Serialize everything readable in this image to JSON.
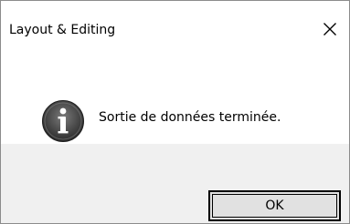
{
  "window": {
    "title": "Layout & Editing",
    "close_icon": "close-icon"
  },
  "message": {
    "icon": "info-icon",
    "text": "Sortie de données terminée."
  },
  "buttons": {
    "ok_label": "OK"
  }
}
